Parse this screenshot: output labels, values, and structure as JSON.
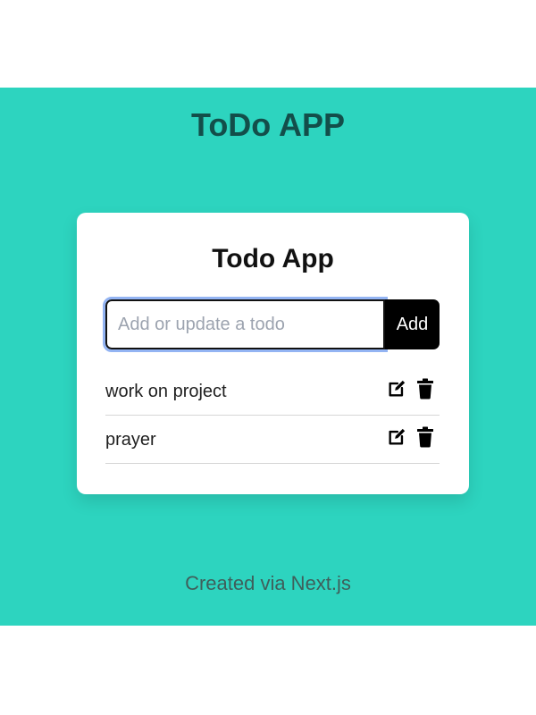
{
  "header": {
    "title": "ToDo APP"
  },
  "card": {
    "title": "Todo App",
    "input": {
      "value": "",
      "placeholder": "Add or update a todo"
    },
    "add_label": "Add",
    "todos": [
      {
        "text": "work on project",
        "edit_icon": "edit-icon",
        "delete_icon": "trash-icon"
      },
      {
        "text": "prayer",
        "edit_icon": "edit-icon",
        "delete_icon": "trash-icon"
      }
    ]
  },
  "footer": {
    "text": "Created via Next.js"
  },
  "colors": {
    "background": "#2dd4bf",
    "title": "#134e4a",
    "card": "#ffffff",
    "button": "#000000",
    "input_focus": "#93b4f3"
  }
}
